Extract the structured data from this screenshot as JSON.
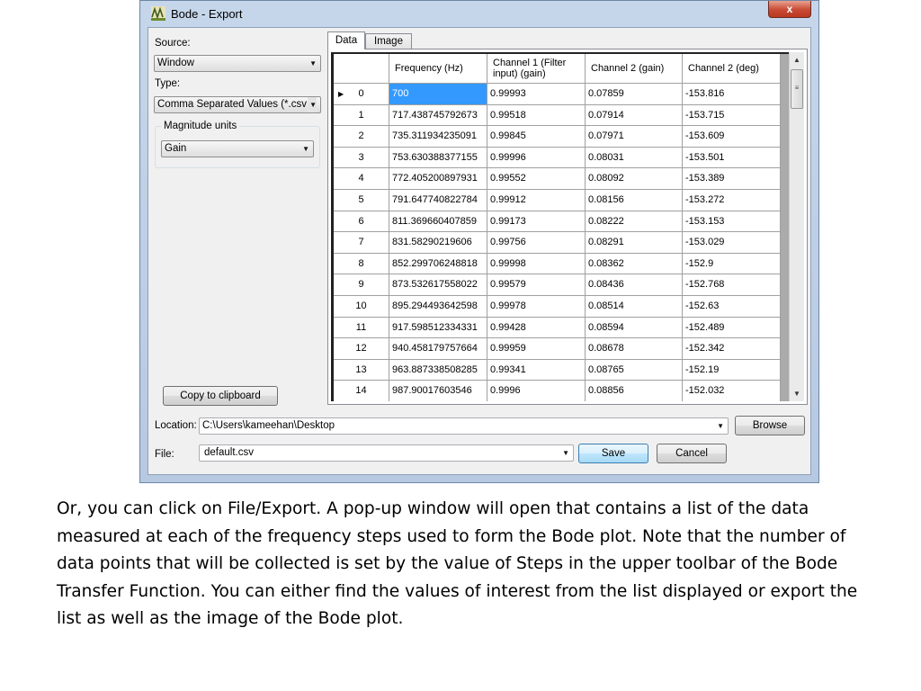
{
  "window": {
    "title": "Bode - Export",
    "close_glyph": "x",
    "icon": "bode-app-icon"
  },
  "left_panel": {
    "source_label": "Source:",
    "source_value": "Window",
    "type_label": "Type:",
    "type_value": "Comma Separated Values (*.csv",
    "magnitude_group_label": "Magnitude units",
    "magnitude_value": "Gain",
    "copy_button": "Copy to clipboard"
  },
  "tabs": [
    {
      "label": "Data",
      "selected": true
    },
    {
      "label": "Image",
      "selected": false
    }
  ],
  "grid": {
    "columns": [
      "Frequency (Hz)",
      "Channel 1 (Filter input) (gain)",
      "Channel 2 (gain)",
      "Channel 2 (deg)"
    ],
    "rows": [
      {
        "index": "0",
        "freq": "700",
        "ch1": "0.99993",
        "ch2g": "0.07859",
        "ch2d": "-153.816"
      },
      {
        "index": "1",
        "freq": "717.438745792673",
        "ch1": "0.99518",
        "ch2g": "0.07914",
        "ch2d": "-153.715"
      },
      {
        "index": "2",
        "freq": "735.311934235091",
        "ch1": "0.99845",
        "ch2g": "0.07971",
        "ch2d": "-153.609"
      },
      {
        "index": "3",
        "freq": "753.630388377155",
        "ch1": "0.99996",
        "ch2g": "0.08031",
        "ch2d": "-153.501"
      },
      {
        "index": "4",
        "freq": "772.405200897931",
        "ch1": "0.99552",
        "ch2g": "0.08092",
        "ch2d": "-153.389"
      },
      {
        "index": "5",
        "freq": "791.647740822784",
        "ch1": "0.99912",
        "ch2g": "0.08156",
        "ch2d": "-153.272"
      },
      {
        "index": "6",
        "freq": "811.369660407859",
        "ch1": "0.99173",
        "ch2g": "0.08222",
        "ch2d": "-153.153"
      },
      {
        "index": "7",
        "freq": "831.58290219606",
        "ch1": "0.99756",
        "ch2g": "0.08291",
        "ch2d": "-153.029"
      },
      {
        "index": "8",
        "freq": "852.299706248818",
        "ch1": "0.99998",
        "ch2g": "0.08362",
        "ch2d": "-152.9"
      },
      {
        "index": "9",
        "freq": "873.532617558022",
        "ch1": "0.99579",
        "ch2g": "0.08436",
        "ch2d": "-152.768"
      },
      {
        "index": "10",
        "freq": "895.294493642598",
        "ch1": "0.99978",
        "ch2g": "0.08514",
        "ch2d": "-152.63"
      },
      {
        "index": "11",
        "freq": "917.598512334331",
        "ch1": "0.99428",
        "ch2g": "0.08594",
        "ch2d": "-152.489"
      },
      {
        "index": "12",
        "freq": "940.458179757664",
        "ch1": "0.99959",
        "ch2g": "0.08678",
        "ch2d": "-152.342"
      },
      {
        "index": "13",
        "freq": "963.887338508285",
        "ch1": "0.99341",
        "ch2g": "0.08765",
        "ch2d": "-152.19"
      },
      {
        "index": "14",
        "freq": "987.90017603546",
        "ch1": "0.9996",
        "ch2g": "0.08856",
        "ch2d": "-152.032"
      }
    ],
    "selected_row": "0",
    "selected_column": "Frequency (Hz)"
  },
  "bottom": {
    "location_label": "Location:",
    "location_value": "C:\\Users\\kameehan\\Desktop",
    "browse_button": "Browse",
    "file_label": "File:",
    "file_value": "default.csv",
    "save_button": "Save",
    "cancel_button": "Cancel"
  },
  "caption": "Or, you can click on File/Export.  A pop-up window will open that contains a list of the data measured at each of the frequency steps used to form the Bode plot.  Note that the number of data points that will be collected is set by the value of Steps in the upper toolbar of the Bode Transfer Function.  You can either find the values of interest from the list displayed or export the list as well as the image of the Bode plot."
}
